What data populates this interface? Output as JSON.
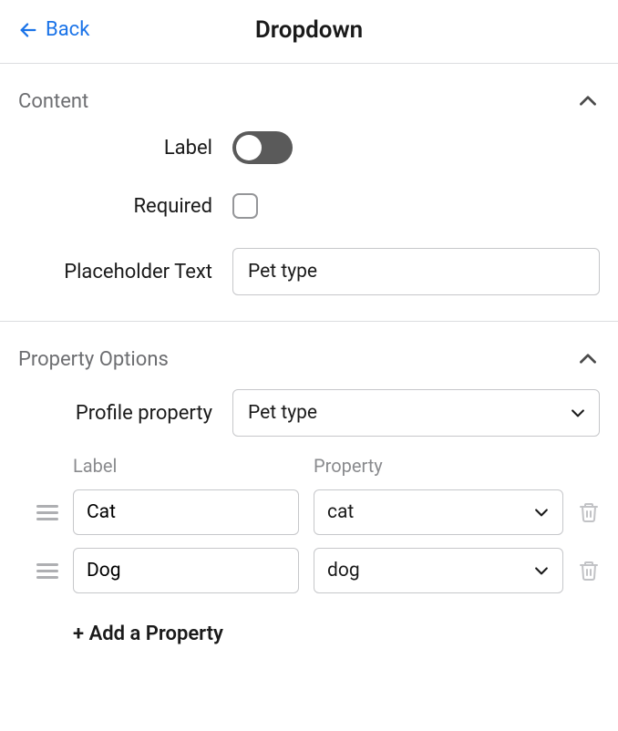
{
  "header": {
    "back_label": "Back",
    "title": "Dropdown"
  },
  "content": {
    "title": "Content",
    "label_field": "Label",
    "required_field": "Required",
    "placeholder_field": "Placeholder Text",
    "placeholder_value": "Pet type"
  },
  "property_options": {
    "title": "Property Options",
    "profile_property_label": "Profile property",
    "profile_property_value": "Pet type",
    "columns": {
      "label": "Label",
      "property": "Property"
    },
    "rows": [
      {
        "label": "Cat",
        "property": "cat"
      },
      {
        "label": "Dog",
        "property": "dog"
      }
    ],
    "add_label": "+ Add a Property"
  }
}
